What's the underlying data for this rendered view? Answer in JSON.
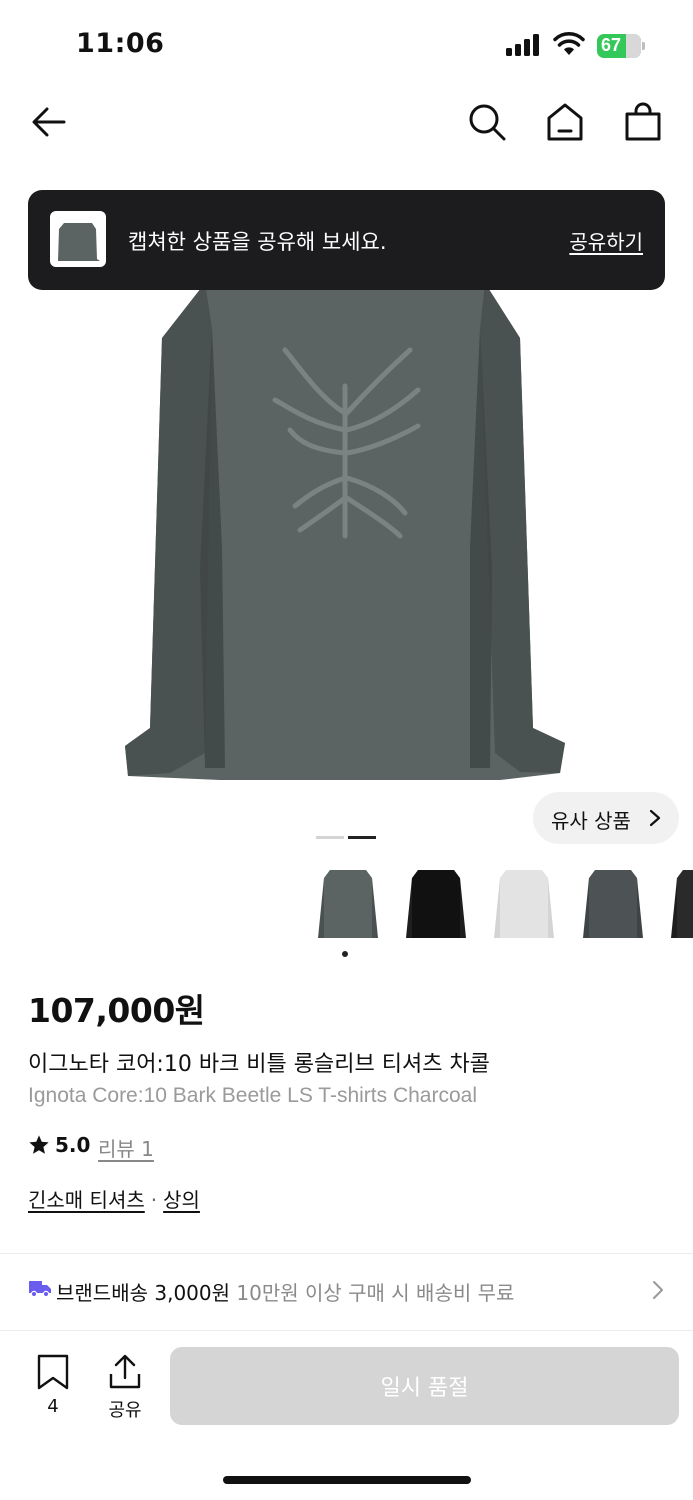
{
  "status_bar": {
    "time": "11:06",
    "battery_percent": "67",
    "battery_level": 0.67,
    "icons": [
      "signal-icon",
      "wifi-icon",
      "battery-icon"
    ]
  },
  "nav": {
    "icons": [
      "back-arrow-icon",
      "search-icon",
      "home-icon",
      "cart-icon"
    ]
  },
  "toast": {
    "message": "캡쳐한 상품을 공유해 보세요.",
    "action_label": "공유하기"
  },
  "gallery": {
    "similar_label": "유사 상품",
    "page_count": 2,
    "current_page": 2,
    "color_swatches": [
      "charcoal",
      "black",
      "light-gray",
      "dark-gray",
      "black"
    ],
    "selected_swatch": 1
  },
  "product": {
    "price": "107,000원",
    "name_ko": "이그노타 코어:10 바크 비틀 롱슬리브 티셔츠 차콜",
    "name_en": "Ignota Core:10 Bark Beetle LS T-shirts Charcoal",
    "rating": "5.0",
    "review_label": "리뷰 1",
    "categories": [
      "긴소매 티셔츠",
      "상의"
    ],
    "category_separator": "·"
  },
  "delivery": {
    "label": "브랜드배송 3,000원",
    "note": "10만원 이상 구매 시 배송비 무료"
  },
  "bottom_bar": {
    "wish_count": "4",
    "share_label": "공유",
    "soldout_label": "일시 품절"
  },
  "colors": {
    "toast_bg": "#1c1c1e",
    "battery_green": "#34c759",
    "delivery_icon": "#6b5cf0",
    "soldout_bg": "#d5d5d5",
    "shirt_charcoal": "#5b6363"
  }
}
